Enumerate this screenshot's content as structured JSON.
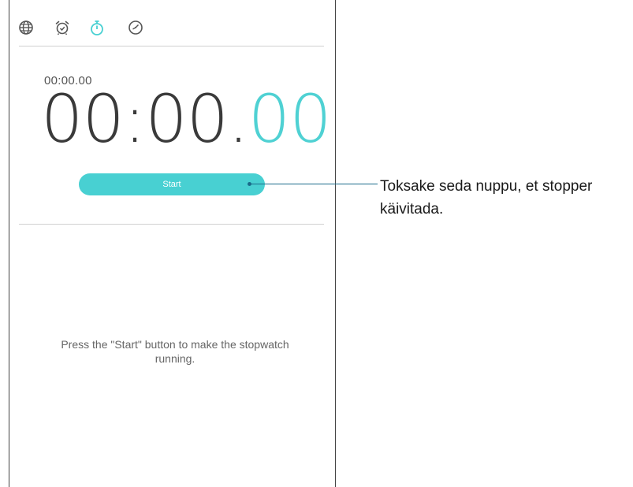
{
  "tabs": [
    {
      "label": "world-clock",
      "icon": "globe-icon",
      "active": false
    },
    {
      "label": "alarm",
      "icon": "alarm-clock-icon",
      "active": false
    },
    {
      "label": "stopwatch",
      "icon": "stopwatch-icon",
      "active": true
    },
    {
      "label": "timer",
      "icon": "timer-icon",
      "active": false
    }
  ],
  "stopwatch": {
    "lap_time": "00:00.00",
    "main_time": "00:00.",
    "main_fraction": "00",
    "start_label": "Start",
    "hint": "Press the \"Start\" button to make the stopwatch running."
  },
  "callout": {
    "text": "Toksake seda nuppu, et stopper käivitada."
  },
  "colors": {
    "accent": "#48d0d2",
    "icon_inactive": "#555555",
    "callout_line": "#1a6b8a"
  }
}
